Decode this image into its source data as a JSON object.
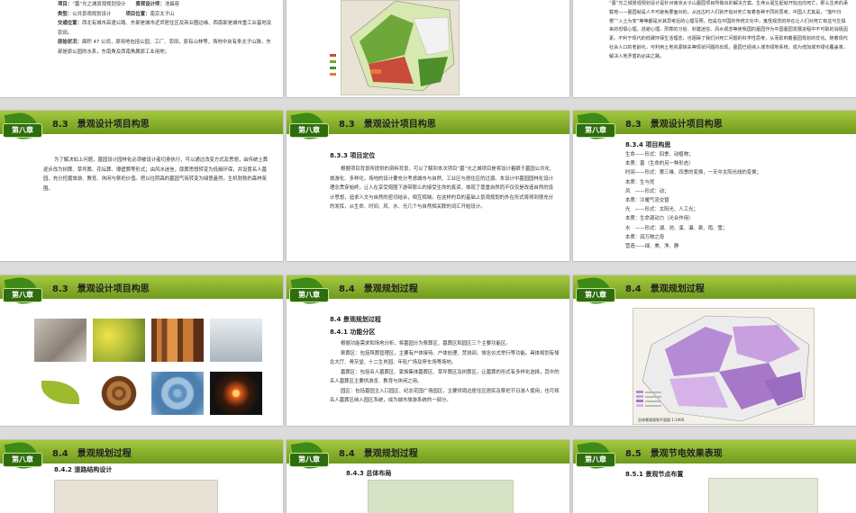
{
  "slides": {
    "s1": {
      "label1": "项目：",
      "project": "“墓”光之城景观规划设计",
      "label2": "景观设计师：",
      "designer": "池晨容",
      "label3": "类型：",
      "type": "公共景观规划设计",
      "label4": "项目位置：",
      "location": "南京太子山",
      "label5": "交通位置：",
      "traffic": "西北有城市高速公路、东部是城市近郊居住区及商业圈边缘、西南部是城市重工业基地及农田。",
      "label6": "原始状况：",
      "status": "面积 47 公顷，原用地包括公园、工厂、农田，原有山林等，场地中央有条太子山脉，东部是原公园的水系，东南角及西南角属原工业用地；"
    },
    "s3": {
      "text": "“墓”光之城景观规划设计是针对南京太子山墓园项目所做出的解决方案。生命从诞生起就开始迈向死亡，那么生命的承载地——墓园就是人不可避免要面对的。从远古时人们就开始对死亡有着各种不同的思考，中国人尤其是，“落叶归根”“入土为安”等等都是对其思考后的心理写照。但是在中国的传统文化中，鬼怪观念的存在让人们对死亡有这与生俱来的恐惧心理，逃避心理，厚葬的习俗、封建迷信、风水观念等使我国的墓园作为中国墓园发展进程中不可取的消极因素。不利于现代的低碳环保生活理念，也阻碍了我们对死亡问题的科学性思考，从而影响着墓园规划的优化。随着现代社会人口的老龄化，可利用土地资源缺失等现状问题的出现，墓园已经纳入城市绿地系统，成为增加城市绿化覆盖率，解决人地矛盾的必由之路。"
    },
    "chapter": "第八章",
    "s4": {
      "title": "8.3　景观设计项目构思",
      "text": "为了解决如上问题，墓园设计园林化必须被设计者切身执行，可以通过改变方式及思想，由传统土葬逐步改为树葬、草坪葬、花坛葬、壕壁葬等形式；由风水迷信，厚葬思想转变为低碳环保，并设置名人墓园，充分挖掘旅游、教育、休闲与祭祀价值。把以往阴森的墓园气氛转变为绿意盎然，生机勃勃的森林氛围。"
    },
    "s5": {
      "title": "8.3　景观设计项目构思",
      "sub": "8.3.3 项目定位",
      "text": "根据项目背景所提供的资料背景，可以了解到本次项目“墓”光之城项目是将设计着眼于墓园公共化、旅游化、多样化，场地的设计要充分考虑城市与自然、工业区与居住区的过渡。本设计中墓园园林化设计理念贯穿始终，让人在享受周围下游带那么的接受生命的真谛，体现了尊重自然而不仅仅是改造自然的设计思想，追求人文与自然的密切结合，相互辉映。在这样的目的基础上景观规划的外在形式将得到很充分的发挥，从生命、时间、风、水、光几个与自然相关联的词汇开始设计。"
    },
    "s6": {
      "title": "8.3　景观设计项目构思",
      "sub": "8.3.4 项目构思",
      "lines": [
        "生命——形式：四季、动植物；",
        "本质：墓（生命的另一种形态）",
        "时间——形式：第三维、四季的变换，一天中太阳光线的变换；",
        "本质：生与死",
        "风　——形式：动；",
        "本质：冷暖气流交替",
        "光　——形式：太阳光、人工光；",
        "本质：生命源动力（光合作用）",
        "水　——形式：湖、池、溪、瀑、泉、雨、雪；",
        "本质：润万物之母",
        "营造——绿、美、净、静"
      ]
    },
    "s7": {
      "title": "8.3　景观设计项目构思"
    },
    "s8": {
      "title": "8.4　景观规划过程",
      "sub1": "8.4 景观规划过程",
      "sub2": "8.4.1 功能分区",
      "p1": "根据功能需求和场地分析，将墓园分为祭葬区、墓葬区和园区三个主要功能区。",
      "p2": "祭葬区：包括殡葬管理区，主要有户体接待、户体处理、焚烧间、悼念仪式举行等功能。具体规划有悼念大厅、骨灰堂、十二生肖园、年轮广场及停车场等场地。",
      "p3": "墓葬区：包括名人墓葬区、家族集体墓葬区、草坪葬区及树葬区。让墓葬的形式有多样化选择，其中的名人墓葬区主要供游览、教育与休闲之用。",
      "p4": "园区：包括墓园主入口园区、纪念花园广场园区，主要供周边居住区居民及祭祀节日游人使用，也可将名人墓葬区纳入园区系统，成为城市旅游系统的一部分。"
    },
    "s9": {
      "title": "8.4　景观规划过程",
      "scale": "总体景观规划平面图 1:1000"
    },
    "s10": {
      "title": "8.4　景观规划过程",
      "sub": "8.4.2 道路结构设计"
    },
    "s11": {
      "title": "8.4　景观规划过程",
      "sub": "8.4.3 总体布局"
    },
    "s12": {
      "title": "8.5　景观节电效果表现",
      "sub": "8.5.1 景观节点布置"
    }
  },
  "colors": {
    "header_green": "#8cb72f",
    "badge_green": "#2d6c0f",
    "background": "#dcdcdc"
  }
}
